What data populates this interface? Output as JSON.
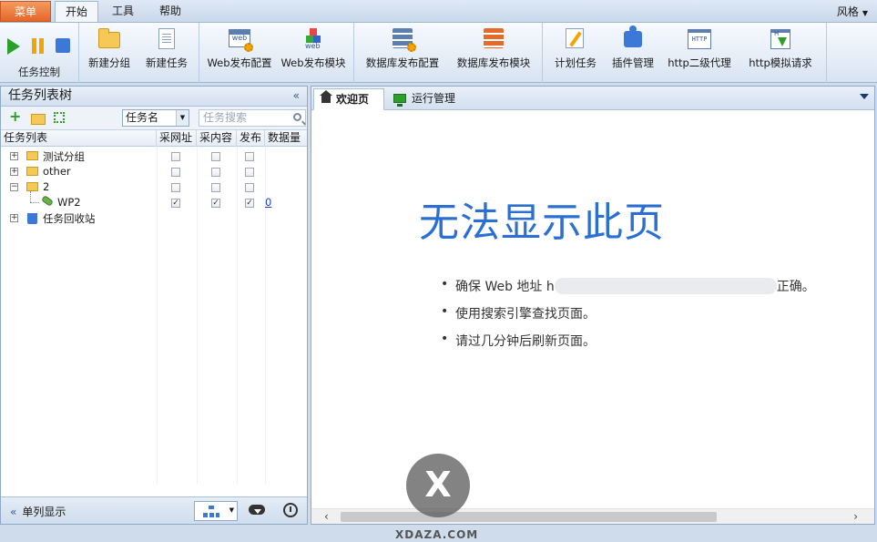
{
  "menubar": {
    "tabs": [
      "菜单",
      "开始",
      "工具",
      "帮助"
    ],
    "style_menu": "风格"
  },
  "ribbon": {
    "task_control_label": "任务控制",
    "buttons": [
      "新建分组",
      "新建任务",
      "Web发布配置",
      "Web发布模块",
      "数据库发布配置",
      "数据库发布模块",
      "计划任务",
      "插件管理",
      "http二级代理",
      "http模拟请求"
    ],
    "icon_texts": {
      "web1": "web",
      "web2": "web",
      "http1": "HTTP",
      "http2": "H"
    }
  },
  "left_panel": {
    "title": "任务列表树",
    "select_value": "任务名",
    "search_placeholder": "任务搜索",
    "columns": [
      "任务列表",
      "采网址",
      "采内容",
      "发布",
      "数据量"
    ],
    "rows": [
      {
        "label": "测试分组",
        "checks": [
          "",
          "",
          ""
        ],
        "count": ""
      },
      {
        "label": "other",
        "checks": [
          "",
          "",
          ""
        ],
        "count": ""
      },
      {
        "label": "2",
        "checks": [
          "",
          "",
          ""
        ],
        "count": ""
      },
      {
        "label": "WP2",
        "checks": [
          "✓",
          "✓",
          "✓"
        ],
        "count": "0"
      },
      {
        "label": "任务回收站",
        "checks": [
          "",
          "",
          ""
        ],
        "count": ""
      }
    ],
    "footer_label": "单列显示"
  },
  "right_panel": {
    "tabs": [
      "欢迎页",
      "运行管理"
    ],
    "error_title": "无法显示此页",
    "error_items": [
      "确保 Web 地址 h",
      "正确。",
      "使用搜索引擎查找页面。",
      "请过几分钟后刷新页面。"
    ]
  },
  "watermark": {
    "mark": "X",
    "text": "XDAZA.COM"
  }
}
